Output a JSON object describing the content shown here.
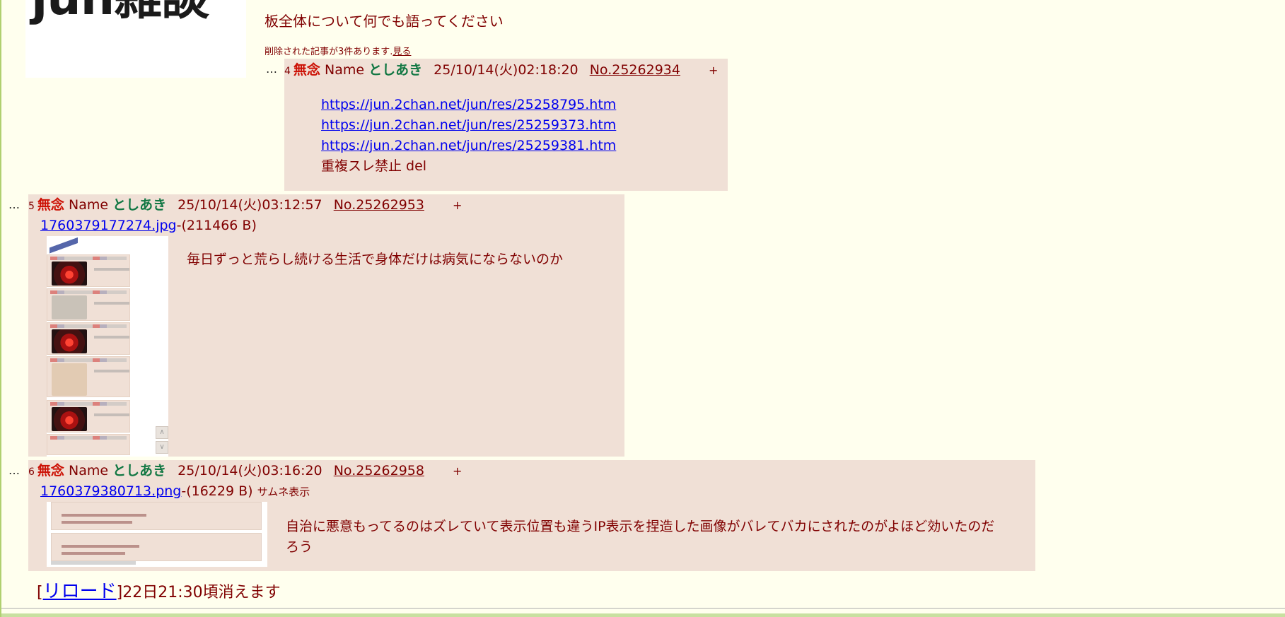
{
  "board": {
    "logo_text": "jun雑談",
    "description": "板全体について何でも語ってください",
    "deleted_note": "削除された記事が3件あります.",
    "deleted_link": "見る"
  },
  "posts": [
    {
      "dots": "…",
      "num": "4",
      "subject": "無念",
      "name_label": "Name",
      "name": "としあき",
      "date": "25/10/14(火)02:18:20",
      "no": "No.25262934",
      "plus": "+",
      "links": [
        "https://jun.2chan.net/jun/res/25258795.htm",
        "https://jun.2chan.net/jun/res/25259373.htm",
        "https://jun.2chan.net/jun/res/25259381.htm"
      ],
      "text": "重複スレ禁止 del"
    },
    {
      "dots": "…",
      "num": "5",
      "subject": "無念",
      "name_label": "Name",
      "name": "としあき",
      "date": "25/10/14(火)03:12:57",
      "no": "No.25262953",
      "plus": "+",
      "file_name": "1760379177274.jpg",
      "file_size": "-(211466 B)",
      "text": "毎日ずっと荒らし続ける生活で身体だけは病気にならないのか"
    },
    {
      "dots": "…",
      "num": "6",
      "subject": "無念",
      "name_label": "Name",
      "name": "としあき",
      "date": "25/10/14(火)03:16:20",
      "no": "No.25262958",
      "plus": "+",
      "file_name": "1760379380713.png",
      "file_size": "-(16229 B)",
      "thumb_label": "サムネ表示",
      "text": "自治に悪意もってるのはズレていて表示位置も違うIP表示を捏造した画像がバレてバカにされたのがよほど効いたのだろう"
    }
  ],
  "footer": {
    "reload_open": "[",
    "reload_label": "リロード",
    "reload_close": "]",
    "expire_text": "22日21:30頃消えます"
  },
  "colors": {
    "background": "#ffffee",
    "reply_bg": "#f0e0d6",
    "text": "#800000",
    "subject": "#cc1105",
    "name": "#117743",
    "link": "#0000ee"
  }
}
